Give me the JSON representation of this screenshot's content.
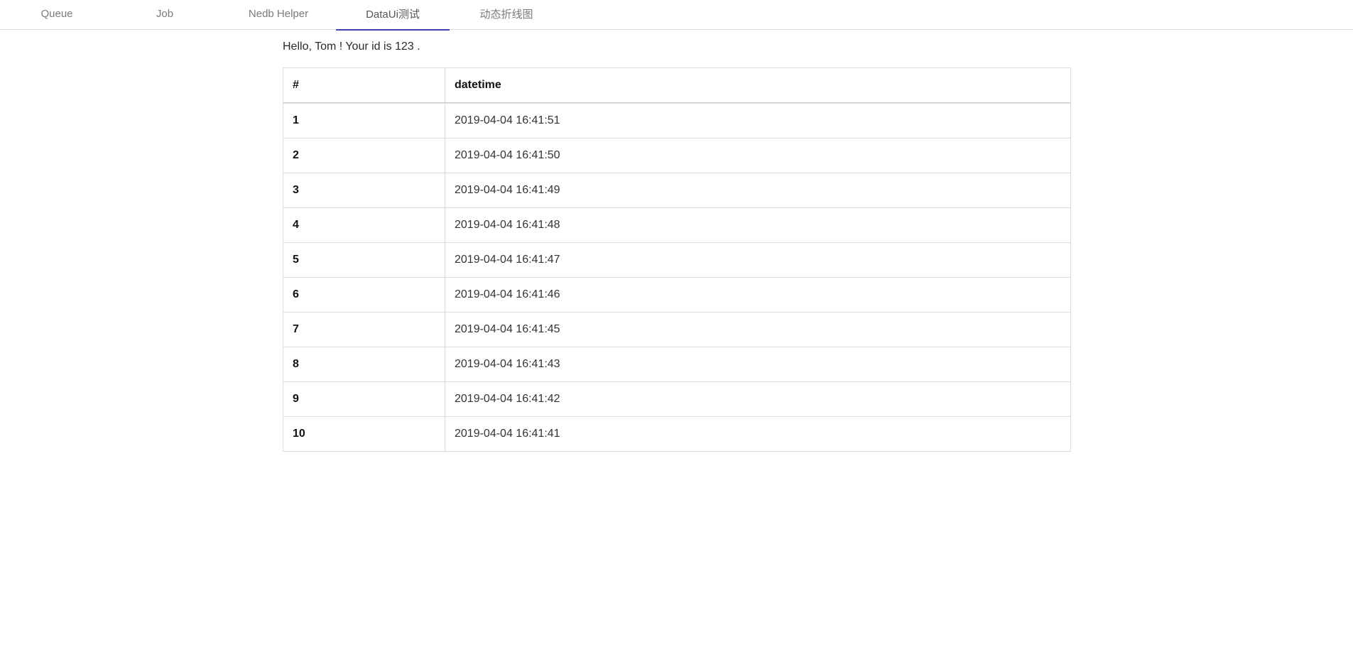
{
  "tabs": [
    {
      "label": "Queue",
      "active": false
    },
    {
      "label": "Job",
      "active": false
    },
    {
      "label": "Nedb Helper",
      "active": false
    },
    {
      "label": "DataUi测试",
      "active": true
    },
    {
      "label": "动态折线图",
      "active": false
    }
  ],
  "greeting": "Hello, Tom ! Your id is 123 .",
  "table": {
    "headers": [
      "#",
      "datetime"
    ],
    "rows": [
      {
        "index": "1",
        "datetime": "2019-04-04 16:41:51"
      },
      {
        "index": "2",
        "datetime": "2019-04-04 16:41:50"
      },
      {
        "index": "3",
        "datetime": "2019-04-04 16:41:49"
      },
      {
        "index": "4",
        "datetime": "2019-04-04 16:41:48"
      },
      {
        "index": "5",
        "datetime": "2019-04-04 16:41:47"
      },
      {
        "index": "6",
        "datetime": "2019-04-04 16:41:46"
      },
      {
        "index": "7",
        "datetime": "2019-04-04 16:41:45"
      },
      {
        "index": "8",
        "datetime": "2019-04-04 16:41:43"
      },
      {
        "index": "9",
        "datetime": "2019-04-04 16:41:42"
      },
      {
        "index": "10",
        "datetime": "2019-04-04 16:41:41"
      }
    ]
  },
  "colors": {
    "active_tab_underline": "#3f3fa8",
    "border": "#dcdcdc"
  }
}
